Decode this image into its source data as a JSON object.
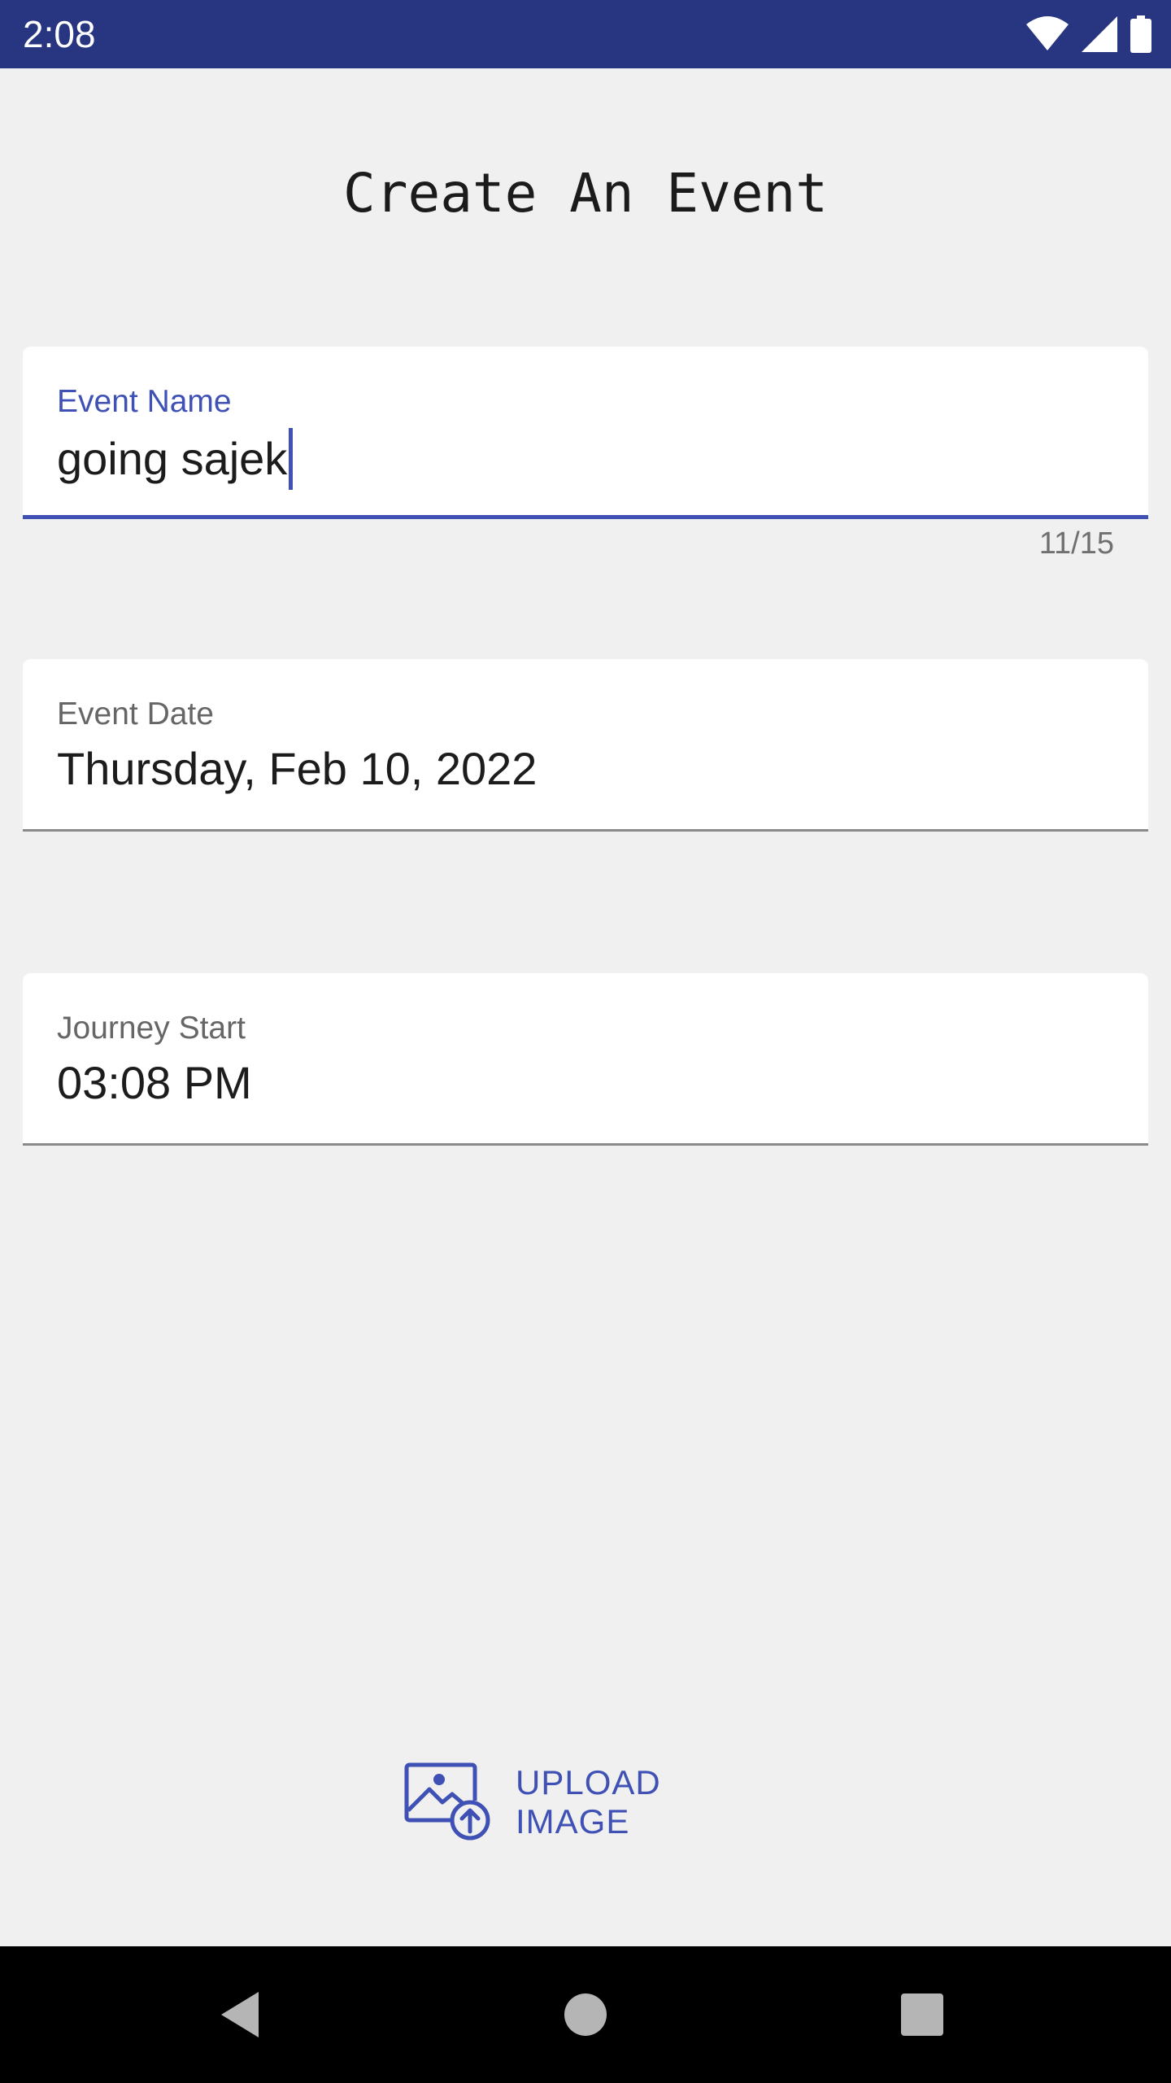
{
  "status_bar": {
    "time": "2:08",
    "icons": [
      "wifi-icon",
      "signal-icon",
      "battery-icon"
    ]
  },
  "title": "Create An Event",
  "fields": {
    "event_name": {
      "label": "Event Name",
      "value": "going sajek",
      "counter": "11/15"
    },
    "event_date": {
      "label": "Event Date",
      "value": "Thursday, Feb 10, 2022"
    },
    "journey_start": {
      "label": "Journey Start",
      "value": "03:08 PM"
    }
  },
  "upload": {
    "label": "UPLOAD IMAGE",
    "icon": "image-upload-icon"
  },
  "nav_bar": {
    "buttons": [
      "back-icon",
      "home-icon",
      "recents-icon"
    ]
  },
  "colors": {
    "status_bar": "#283580",
    "accent": "#3f51b5",
    "background": "#f0f0f0"
  }
}
